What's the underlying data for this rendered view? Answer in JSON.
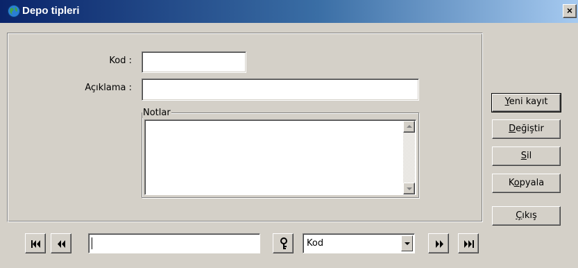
{
  "window": {
    "title": "Depo tipleri",
    "close_glyph": "×",
    "title_icon": "globe-icon"
  },
  "form": {
    "kod_label": "Kod :",
    "kod_value": "",
    "aciklama_label": "Açıklama :",
    "aciklama_value": "",
    "notlar_label": "Notlar",
    "notlar_value": ""
  },
  "buttons": {
    "new": {
      "mnemonic": "Y",
      "rest": "eni kayıt"
    },
    "edit": {
      "mnemonic": "D",
      "rest": "eğiştir"
    },
    "delete": {
      "mnemonic": "S",
      "rest": "il"
    },
    "copy": {
      "pre": "K",
      "mnemonic": "o",
      "rest": "pyala"
    },
    "exit": {
      "mnemonic": "Ç",
      "rest": "ıkış"
    }
  },
  "navigator": {
    "search_value": "",
    "sort_field": "Kod",
    "icons": [
      "first-record-icon",
      "previous-record-icon",
      "search-key-icon",
      "next-record-icon",
      "last-record-icon"
    ]
  },
  "colors": {
    "face": "#d4d0c8",
    "title_start": "#0a246a",
    "title_end": "#a6caf0"
  }
}
